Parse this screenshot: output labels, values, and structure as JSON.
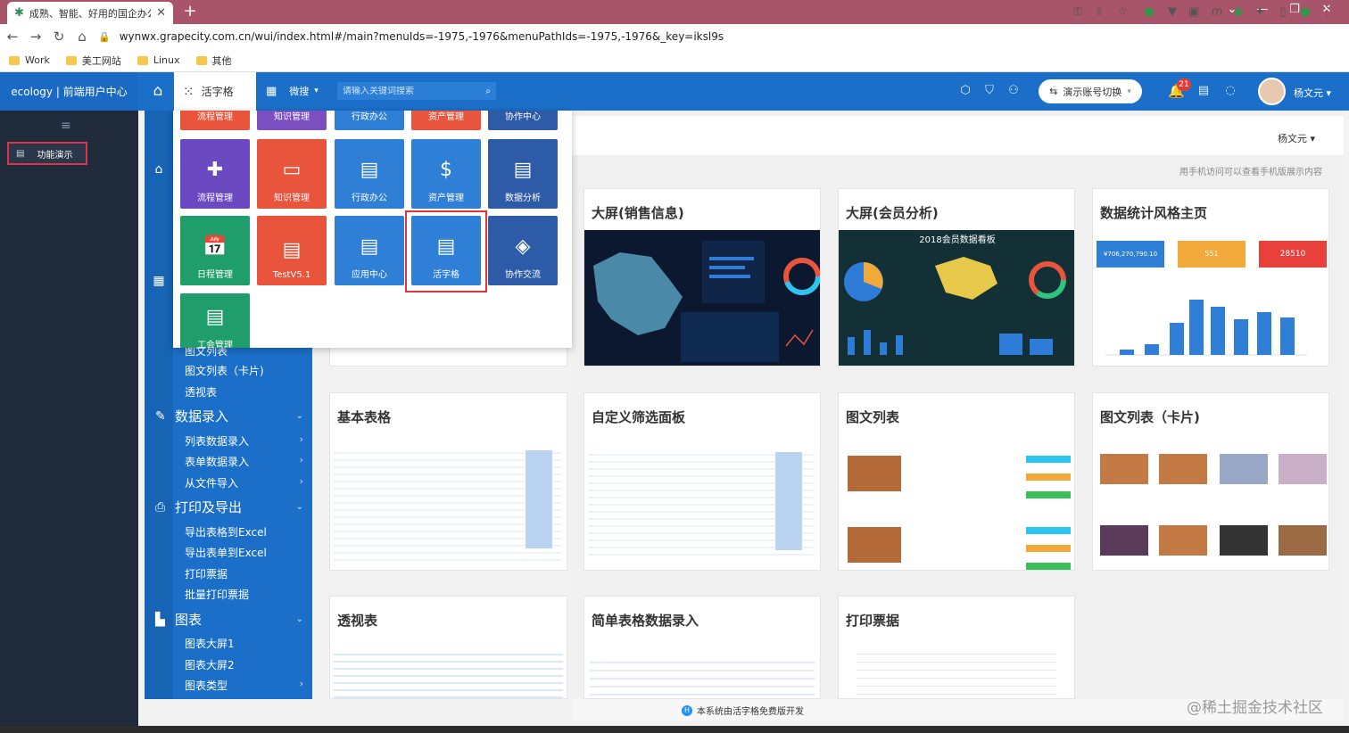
{
  "browser": {
    "tab_title": "成熟、智能、好用的国企办公平台",
    "url": "wynwx.grapecity.com.cn/wui/index.html#/main?menuIds=-1975,-1976&menuPathIds=-1975,-1976&_key=iksl9s",
    "bookmarks": [
      "Work",
      "美工网站",
      "Linux",
      "其他"
    ]
  },
  "header": {
    "brand": "ecology | 前端用户中心",
    "active_tab": "活字格",
    "weisou": "微搜",
    "search_placeholder": "请输入关键词搜索",
    "account_switch": "演示账号切换",
    "notification_count": "21",
    "user_name": "杨文元"
  },
  "left_sidebar": {
    "item": "功能演示"
  },
  "popup": {
    "top_row_cut": [
      "流程管理",
      "知识管理",
      "行政办公",
      "资产管理",
      "协作中心"
    ],
    "row1": [
      "流程管理",
      "知识管理",
      "行政办公",
      "资产管理",
      "数据分析"
    ],
    "row2": [
      "日程管理",
      "TestV5.1",
      "应用中心",
      "活字格",
      "协作交流"
    ],
    "row3": [
      "工会管理"
    ]
  },
  "subnav": {
    "items_top": [
      "图文列表",
      "图文列表（卡片)",
      "透视表"
    ],
    "groups": [
      {
        "label": "数据录入",
        "items": [
          "列表数据录入",
          "表单数据录入",
          "从文件导入"
        ]
      },
      {
        "label": "打印及导出",
        "items": [
          "导出表格到Excel",
          "导出表单到Excel",
          "打印票据",
          "批量打印票据"
        ]
      },
      {
        "label": "图表",
        "items": [
          "图表大屏1",
          "图表大屏2",
          "图表类型"
        ]
      }
    ]
  },
  "main": {
    "user_menu": "杨文元 ▾",
    "hint": "用手机访问可以查看手机版展示内容",
    "cards": [
      "大屏(销售信息)",
      "大屏(会员分析)",
      "数据统计风格主页",
      "基本表格",
      "自定义筛选面板",
      "图文列表",
      "图文列表（卡片)",
      "透视表",
      "简单表格数据录入",
      "打印票据"
    ],
    "stat_values": [
      "¥706,270,790.10",
      "551",
      "28510"
    ],
    "big_screen_title": "2018会员数据看板",
    "footer": "本系统由活字格免费版开发",
    "watermark": "@稀土掘金技术社区"
  },
  "colors": {
    "header_blue": "#1b6fc8",
    "sidebar_dark": "#1f2a3a",
    "tile_purple": "#6b49c0",
    "tile_red": "#e8543c",
    "tile_blue": "#2f7fd6",
    "tile_navy": "#2e5ba8",
    "tile_green": "#1f9e6b",
    "highlight_red": "#e0353c"
  }
}
